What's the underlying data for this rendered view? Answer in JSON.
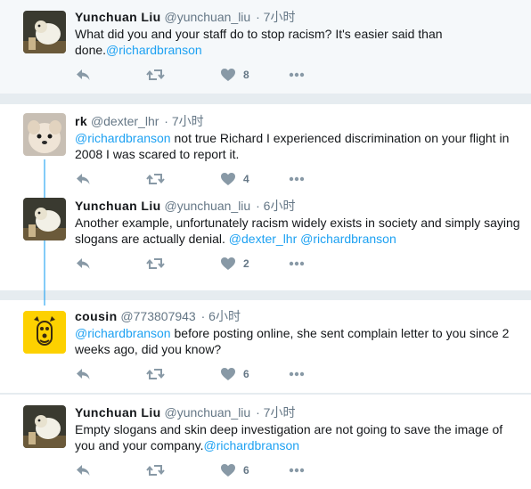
{
  "colors": {
    "mention": "#1da1f2",
    "muted": "#657786",
    "text": "#14171a",
    "bg": "#e6ecf0"
  },
  "icons": {
    "reply": "reply-icon",
    "retweet": "retweet-icon",
    "like": "heart-icon",
    "more": "more-dots-icon"
  },
  "tweets": [
    {
      "name": "Yunchuan Liu",
      "handle": "@yunchuan_liu",
      "time": "· 7小时",
      "text_before": "What did you and your staff do to stop racism? It's easier said than done.",
      "mention1": "@richardbranson",
      "text_mid": "",
      "mention2": "",
      "text_after": "",
      "likes": "8"
    },
    {
      "name": "rk",
      "handle": "@dexter_lhr",
      "time": "· 7小时",
      "text_before": "",
      "mention1": "@richardbranson",
      "text_mid": " not true Richard I experienced discrimination on your flight in 2008 I was scared to report it.",
      "mention2": "",
      "text_after": "",
      "likes": "4"
    },
    {
      "name": "Yunchuan Liu",
      "handle": "@yunchuan_liu",
      "time": "· 6小时",
      "text_before": "Another example, unfortunately racism widely exists in society and simply saying slogans are actually denial. ",
      "mention1": "@dexter_lhr",
      "text_mid": " ",
      "mention2": "@richardbranson",
      "text_after": "",
      "likes": "2"
    },
    {
      "name": "cousin",
      "handle": "@773807943",
      "time": "· 6小时",
      "text_before": "",
      "mention1": "@richardbranson",
      "text_mid": " before posting online, she sent complain letter to you since 2 weeks ago, did you know?",
      "mention2": "",
      "text_after": "",
      "likes": "6"
    },
    {
      "name": "Yunchuan Liu",
      "handle": "@yunchuan_liu",
      "time": "· 7小时",
      "text_before": "Empty slogans and skin deep investigation are not going to save the image of you and your company.",
      "mention1": "@richardbranson",
      "text_mid": "",
      "mention2": "",
      "text_after": "",
      "likes": "6"
    }
  ]
}
